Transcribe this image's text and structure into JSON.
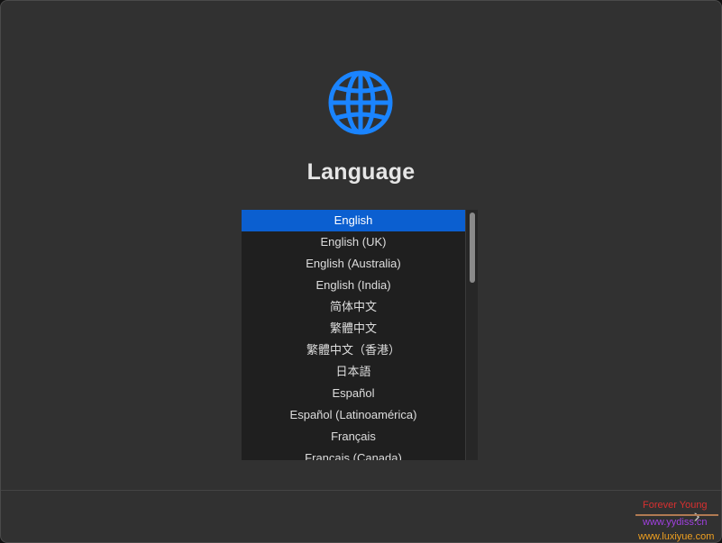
{
  "header": {
    "icon": "globe-icon",
    "title": "Language"
  },
  "language_list": {
    "selected_index": 0,
    "items": [
      "English",
      "English (UK)",
      "English (Australia)",
      "English (India)",
      "简体中文",
      "繁體中文",
      "繁體中文（香港）",
      "日本語",
      "Español",
      "Español (Latinoamérica)",
      "Français",
      "Français (Canada)"
    ]
  },
  "footer": {
    "next_icon": "chevron-right-icon",
    "next_glyph": "›"
  },
  "watermark": {
    "line1": "Forever Young",
    "line2": "www.yydiss.cn",
    "line3": "www.luxiyue.com"
  },
  "colors": {
    "accent": "#0b5fd0",
    "globe": "#1a84ff",
    "window_bg": "#313131",
    "list_bg": "#1f1f1f"
  }
}
